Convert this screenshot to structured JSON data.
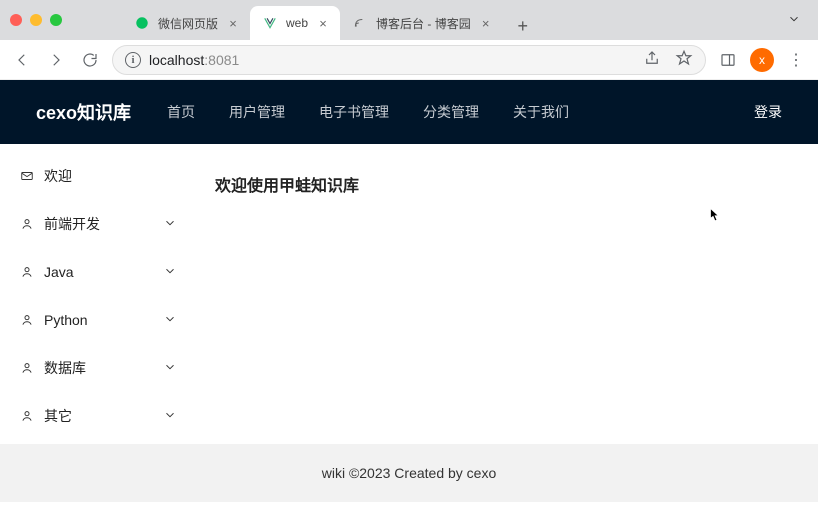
{
  "browser": {
    "tabs": [
      {
        "label": "微信网页版",
        "active": false,
        "favicon": "wechat"
      },
      {
        "label": "web",
        "active": true,
        "favicon": "vue"
      },
      {
        "label": "博客后台 - 博客园",
        "active": false,
        "favicon": "cnblogs"
      }
    ],
    "address": {
      "host": "localhost",
      "port": ":8081"
    },
    "avatar_letter": "x"
  },
  "header": {
    "brand": "cexo知识库",
    "menu": [
      "首页",
      "用户管理",
      "电子书管理",
      "分类管理",
      "关于我们"
    ],
    "login": "登录"
  },
  "sidebar": {
    "items": [
      {
        "icon": "mail",
        "label": "欢迎",
        "expandable": false
      },
      {
        "icon": "user",
        "label": "前端开发",
        "expandable": true
      },
      {
        "icon": "user",
        "label": "Java",
        "expandable": true
      },
      {
        "icon": "user",
        "label": "Python",
        "expandable": true
      },
      {
        "icon": "user",
        "label": "数据库",
        "expandable": true
      },
      {
        "icon": "user",
        "label": "其它",
        "expandable": true
      }
    ]
  },
  "main": {
    "welcome": "欢迎使用甲蛙知识库"
  },
  "footer": {
    "text": "wiki ©2023 Created by cexo"
  }
}
